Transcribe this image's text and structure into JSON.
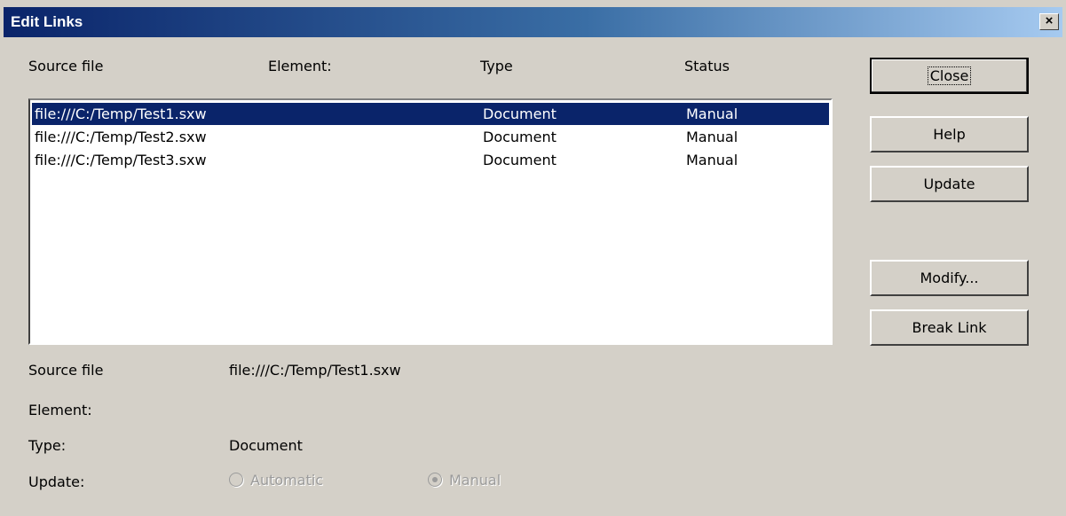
{
  "window": {
    "title": "Edit Links",
    "close_glyph": "×"
  },
  "columns": [
    "Source file",
    "Element:",
    "Type",
    "Status"
  ],
  "rows": [
    {
      "source": "file:///C:/Temp/Test1.sxw",
      "element": "",
      "type": "Document",
      "status": "Manual",
      "selected": true
    },
    {
      "source": "file:///C:/Temp/Test2.sxw",
      "element": "",
      "type": "Document",
      "status": "Manual",
      "selected": false
    },
    {
      "source": "file:///C:/Temp/Test3.sxw",
      "element": "",
      "type": "Document",
      "status": "Manual",
      "selected": false
    }
  ],
  "buttons": {
    "close": "Close",
    "help": "Help",
    "update": "Update",
    "modify": "Modify...",
    "break_link": "Break Link"
  },
  "details": {
    "source_file_label": "Source file",
    "source_file_value": "file:///C:/Temp/Test1.sxw",
    "element_label": "Element:",
    "element_value": "",
    "type_label": "Type:",
    "type_value": "Document",
    "update_label": "Update:",
    "update_options": [
      {
        "label": "Automatic",
        "checked": false,
        "enabled": false
      },
      {
        "label": "Manual",
        "checked": true,
        "enabled": false
      }
    ]
  },
  "colors": {
    "selection": "#0a246a",
    "dialog_bg": "#d4d0c8"
  }
}
